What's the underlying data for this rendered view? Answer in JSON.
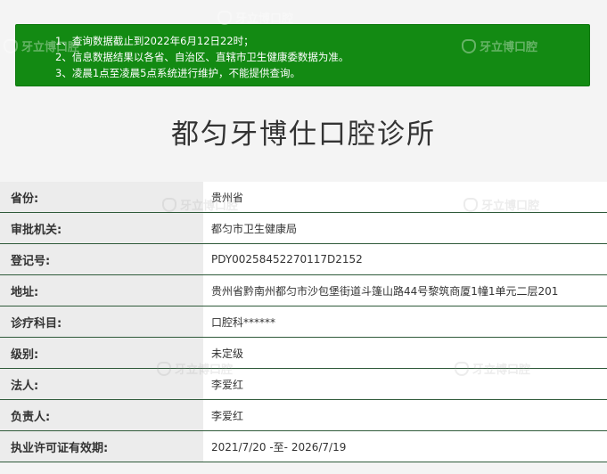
{
  "notice": {
    "lines": [
      "1、查询数据截止到2022年6月12日22时；",
      "2、信息数据结果以各省、自治区、直辖市卫生健康委数据为准。",
      "3、凌晨1点至凌晨5点系统进行维护，不能提供查询。"
    ]
  },
  "clinic": {
    "name": "都匀牙博仕口腔诊所"
  },
  "watermark": {
    "text": "牙立博口腔",
    "icon": "tooth-logo-icon"
  },
  "details": [
    {
      "label": "省份:",
      "value": "贵州省"
    },
    {
      "label": "审批机关:",
      "value": "都匀市卫生健康局"
    },
    {
      "label": "登记号:",
      "value": "PDY00258452270117D2152"
    },
    {
      "label": "地址:",
      "value": "贵州省黔南州都匀市沙包堡街道斗篷山路44号黎筑商厦1幢1单元二层201"
    },
    {
      "label": "诊疗科目:",
      "value": "口腔科******"
    },
    {
      "label": "级别:",
      "value": "未定级"
    },
    {
      "label": "法人:",
      "value": "李爱红"
    },
    {
      "label": "负责人:",
      "value": "李爱红"
    },
    {
      "label": "执业许可证有效期:",
      "value": "2021/7/20 -至- 2026/7/19"
    }
  ]
}
